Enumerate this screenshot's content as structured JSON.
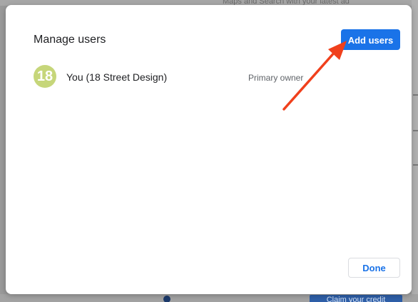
{
  "background": {
    "top_text": "Maps and Search with your latest ad",
    "bottom_button": "Claim your credit"
  },
  "dialog": {
    "title": "Manage users",
    "add_users_label": "Add users",
    "done_label": "Done",
    "users": [
      {
        "avatar_text": "18",
        "name": "You (18 Street Design)",
        "role": "Primary owner",
        "avatar_color": "#c6d67a"
      }
    ]
  },
  "colors": {
    "accent": "#1a73e8",
    "annotation_arrow": "#f0401c"
  },
  "icons": {
    "annotation": "red-arrow-icon"
  }
}
